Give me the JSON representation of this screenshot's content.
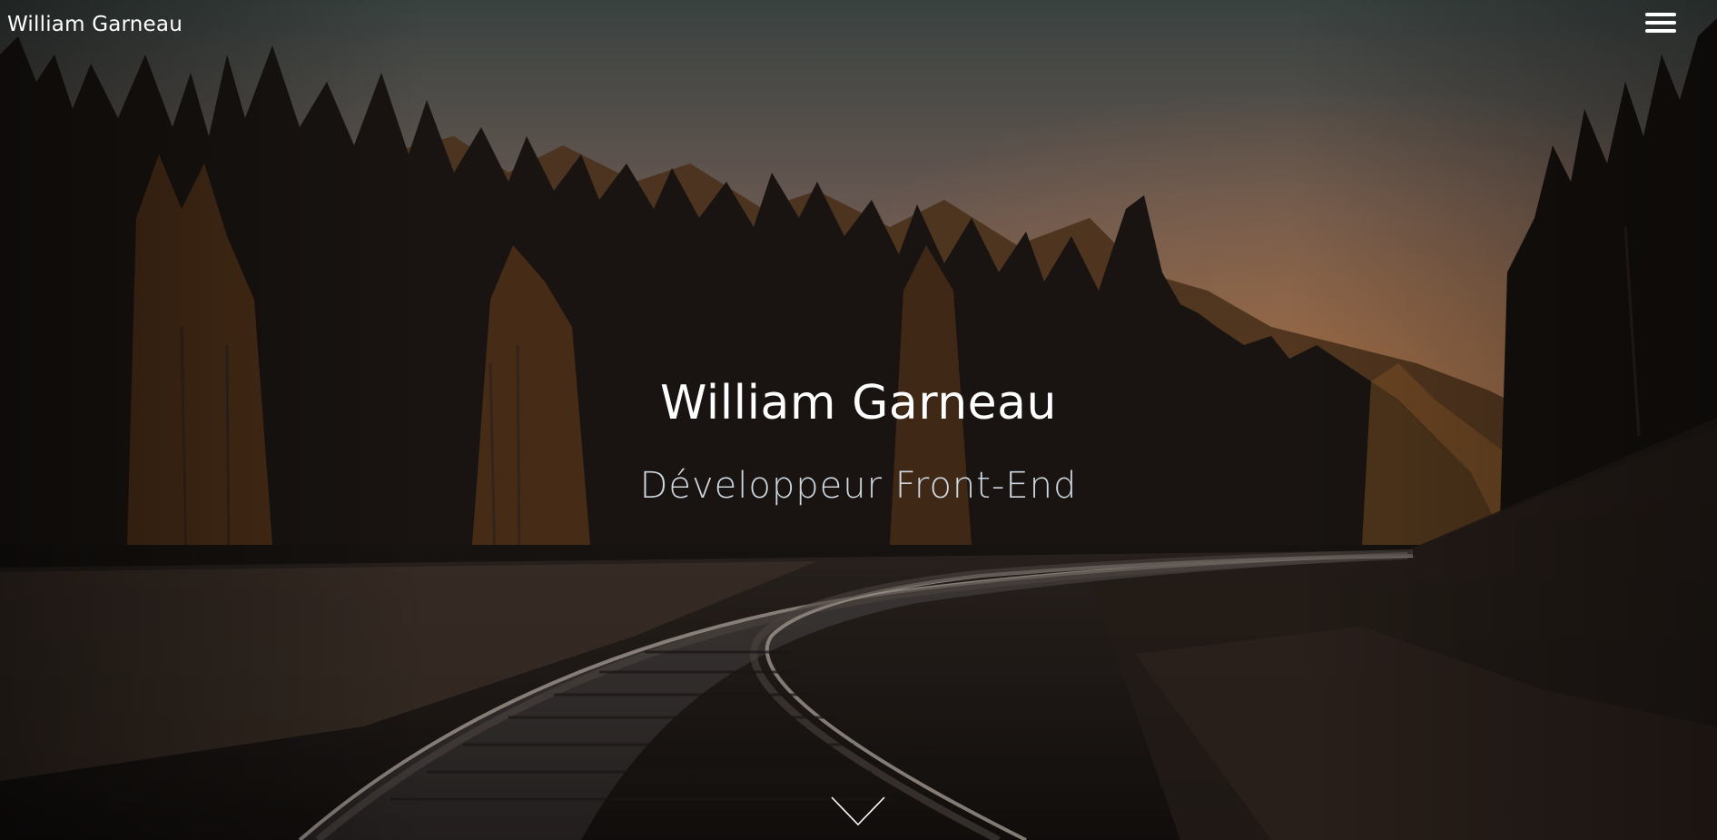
{
  "header": {
    "brand": "William Garneau",
    "menu_icon": "hamburger-menu-icon"
  },
  "hero": {
    "title": "William Garneau",
    "subtitle": "Développeur Front-End",
    "scroll_icon": "chevron-down-icon"
  },
  "colors": {
    "text": "#ffffff",
    "subtitle": "#dfe9f2",
    "sky_top": "#46514f",
    "sky_bottom": "#c7824f"
  }
}
